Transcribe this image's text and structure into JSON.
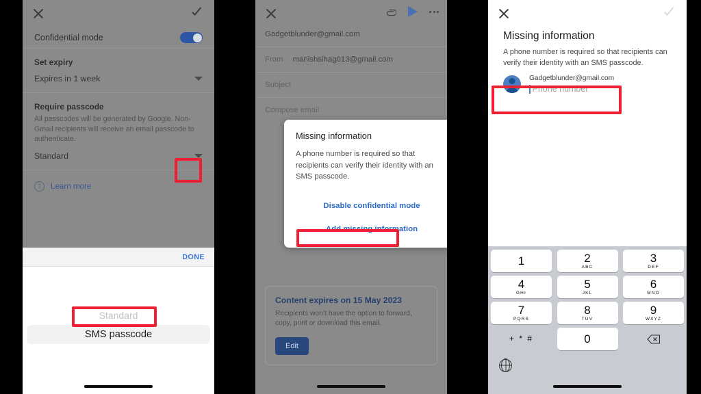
{
  "panel1": {
    "name": "confidential-mode-settings",
    "topbar": {
      "close_icon": "close-icon",
      "confirm_icon": "check-icon"
    },
    "confidential_toggle": {
      "label": "Confidential mode",
      "state": "on"
    },
    "set_expiry": {
      "title": "Set expiry",
      "value": "Expires in 1 week",
      "caret_icon": "chevron-down-icon"
    },
    "require_passcode": {
      "title": "Require passcode",
      "description": "All passcodes will be generated by Google. Non-Gmail recipients will receive an email passcode to authenticate.",
      "value": "Standard",
      "caret_icon": "chevron-down-icon"
    },
    "learn_more": {
      "label": "Learn more",
      "icon": "help-circle-icon",
      "glyph": "?"
    },
    "picker": {
      "done_label": "DONE",
      "faded_option": "Standard",
      "selected_option": "SMS passcode",
      "options": [
        "Standard",
        "SMS passcode"
      ]
    }
  },
  "panel2": {
    "name": "compose-with-missing-info-dialog",
    "topbar": {
      "close_icon": "close-icon",
      "attach_icon": "paperclip-icon",
      "send_icon": "send-icon",
      "more_icon": "overflow-menu-icon"
    },
    "to_value": "Gadgetblunder@gmail.com",
    "from_label": "From",
    "from_value": "manishsihag013@gmail.com",
    "subject_placeholder": "Subject",
    "body_placeholder": "Compose email",
    "dialog": {
      "title": "Missing information",
      "text": "A phone number is required so that recipients can verify their identity with an SMS passcode.",
      "disable_label": "Disable confidential mode",
      "add_label": "Add missing information"
    },
    "expiry_card": {
      "title": "Content expires on 15 May 2023",
      "description": "Recipients won’t have the option to forward, copy, print or download this email.",
      "edit_label": "Edit"
    }
  },
  "panel3": {
    "name": "missing-information-phone-entry",
    "topbar": {
      "close_icon": "close-icon",
      "confirm_icon": "check-icon"
    },
    "title": "Missing information",
    "subtitle": "A phone number is required so that recipients can verify their identity with an SMS passcode.",
    "contact": {
      "avatar_icon": "person-avatar-icon",
      "email": "Gadgetblunder@gmail.com",
      "phone_placeholder": "Phone number",
      "phone_value": ""
    },
    "keypad": {
      "keys": [
        {
          "num": "1",
          "sub": ""
        },
        {
          "num": "2",
          "sub": "ABC"
        },
        {
          "num": "3",
          "sub": "DEF"
        },
        {
          "num": "4",
          "sub": "GHI"
        },
        {
          "num": "5",
          "sub": "JKL"
        },
        {
          "num": "6",
          "sub": "MNO"
        },
        {
          "num": "7",
          "sub": "PQRS"
        },
        {
          "num": "8",
          "sub": "TUV"
        },
        {
          "num": "9",
          "sub": "WXYZ"
        }
      ],
      "symbols_key": "+ * #",
      "zero_key": "0",
      "backspace_icon": "backspace-icon",
      "globe_icon": "globe-language-icon"
    }
  },
  "annotations": {
    "accent_color": "#ee2033",
    "boxes": [
      {
        "name": "passcode-dropdown-highlight",
        "target": "panel1 require-passcode caret"
      },
      {
        "name": "sms-passcode-option-highlight",
        "target": "panel1 picker selected option"
      },
      {
        "name": "add-missing-information-highlight",
        "target": "panel2 dialog add button"
      },
      {
        "name": "phone-number-field-highlight",
        "target": "panel3 contact phone row"
      }
    ]
  }
}
